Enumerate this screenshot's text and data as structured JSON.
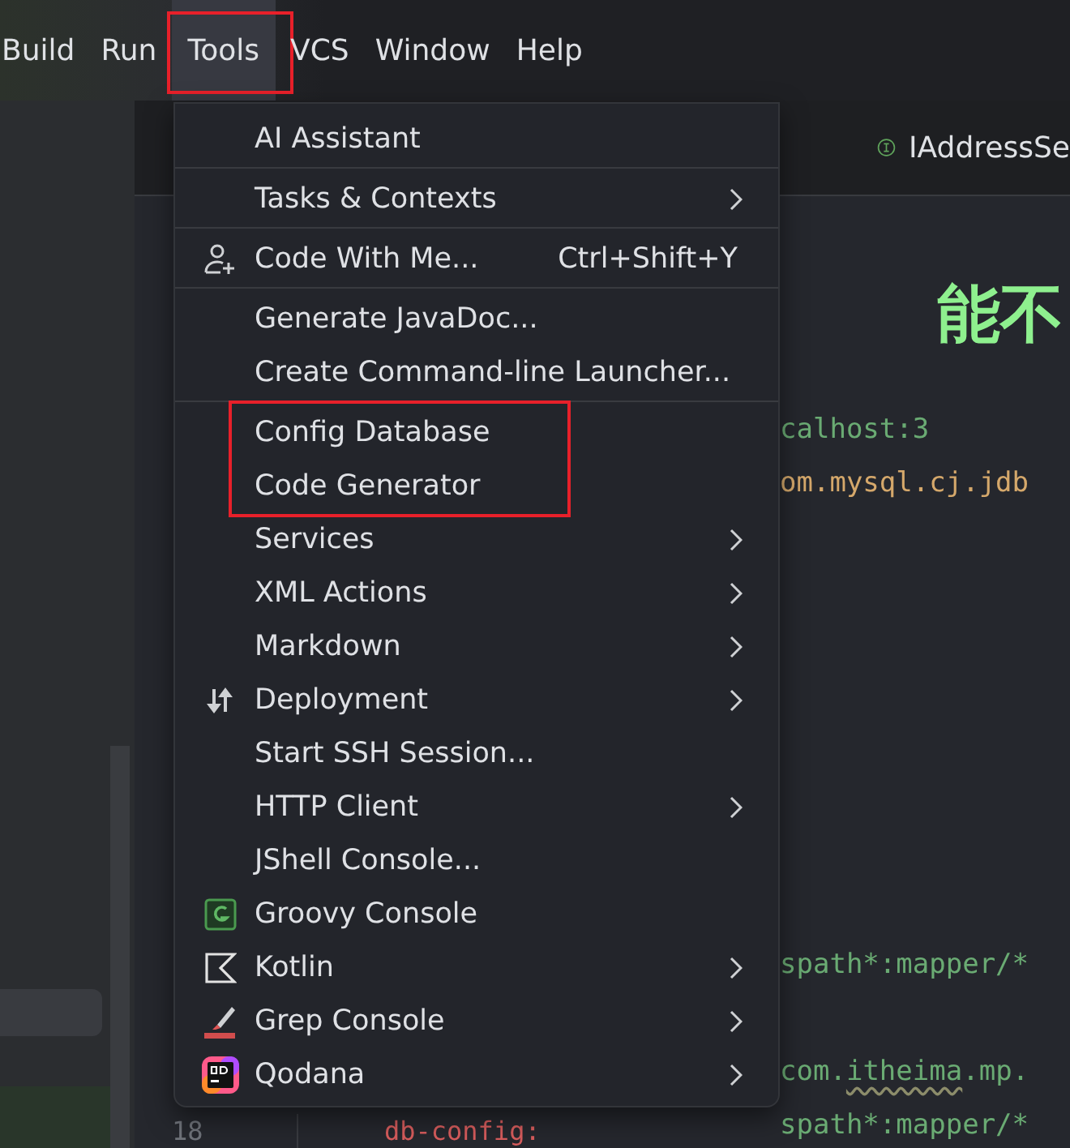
{
  "menubar": {
    "items": [
      {
        "label": "Build",
        "selected": false,
        "outlined": false
      },
      {
        "label": "Run",
        "selected": false,
        "outlined": false
      },
      {
        "label": "Tools",
        "selected": true,
        "outlined": true
      },
      {
        "label": "VCS",
        "selected": false,
        "outlined": false
      },
      {
        "label": "Window",
        "selected": false,
        "outlined": false
      },
      {
        "label": "Help",
        "selected": false,
        "outlined": false
      }
    ]
  },
  "editor_tab": {
    "label": "IAddressSe"
  },
  "overlay_caption": "能不",
  "code_lines": [
    {
      "kind": "string",
      "text": "calhost:3"
    },
    {
      "kind": "class",
      "text": "om.mysql.cj.jdb"
    },
    {
      "kind": "blank"
    },
    {
      "kind": "blank"
    },
    {
      "kind": "blank"
    },
    {
      "kind": "blank"
    },
    {
      "kind": "blank"
    },
    {
      "kind": "blank"
    },
    {
      "kind": "blank"
    },
    {
      "kind": "blank"
    },
    {
      "kind": "string",
      "text": "spath*:mapper/*"
    },
    {
      "kind": "blank"
    },
    {
      "kind": "package",
      "text": "com.itheima.mp."
    },
    {
      "kind": "string",
      "text": "spath*:mapper/*"
    }
  ],
  "bottom_line": {
    "number": "18",
    "text": "db-config:"
  },
  "tools_menu": {
    "groups": [
      {
        "outlined": false,
        "divider_after": true,
        "items": [
          {
            "label": "AI Assistant",
            "submenu": false
          }
        ]
      },
      {
        "outlined": false,
        "divider_after": true,
        "items": [
          {
            "label": "Tasks & Contexts",
            "submenu": true
          }
        ]
      },
      {
        "outlined": false,
        "divider_after": true,
        "items": [
          {
            "label": "Code With Me...",
            "kind": "person",
            "shortcut": "Ctrl+Shift+Y",
            "submenu": false
          }
        ]
      },
      {
        "outlined": false,
        "divider_after": true,
        "items": [
          {
            "label": "Generate JavaDoc...",
            "submenu": false
          },
          {
            "label": "Create Command-line Launcher...",
            "submenu": false
          }
        ]
      },
      {
        "outlined": true,
        "divider_after": false,
        "items": [
          {
            "label": "Config Database",
            "submenu": false
          },
          {
            "label": "Code Generator",
            "submenu": false
          }
        ]
      },
      {
        "outlined": false,
        "divider_after": false,
        "items": [
          {
            "label": "Services",
            "submenu": true
          },
          {
            "label": "XML Actions",
            "submenu": true
          },
          {
            "label": "Markdown",
            "submenu": true
          },
          {
            "label": "Deployment",
            "kind": "deploy",
            "submenu": true
          },
          {
            "label": "Start SSH Session...",
            "submenu": false
          },
          {
            "label": "HTTP Client",
            "submenu": true
          },
          {
            "label": "JShell Console...",
            "submenu": false
          },
          {
            "label": "Groovy Console",
            "kind": "groovy",
            "submenu": false
          },
          {
            "label": "Kotlin",
            "kind": "kotlin",
            "submenu": true
          },
          {
            "label": "Grep Console",
            "kind": "grep",
            "submenu": true
          },
          {
            "label": "Qodana",
            "kind": "qodana",
            "submenu": true
          }
        ]
      }
    ]
  }
}
